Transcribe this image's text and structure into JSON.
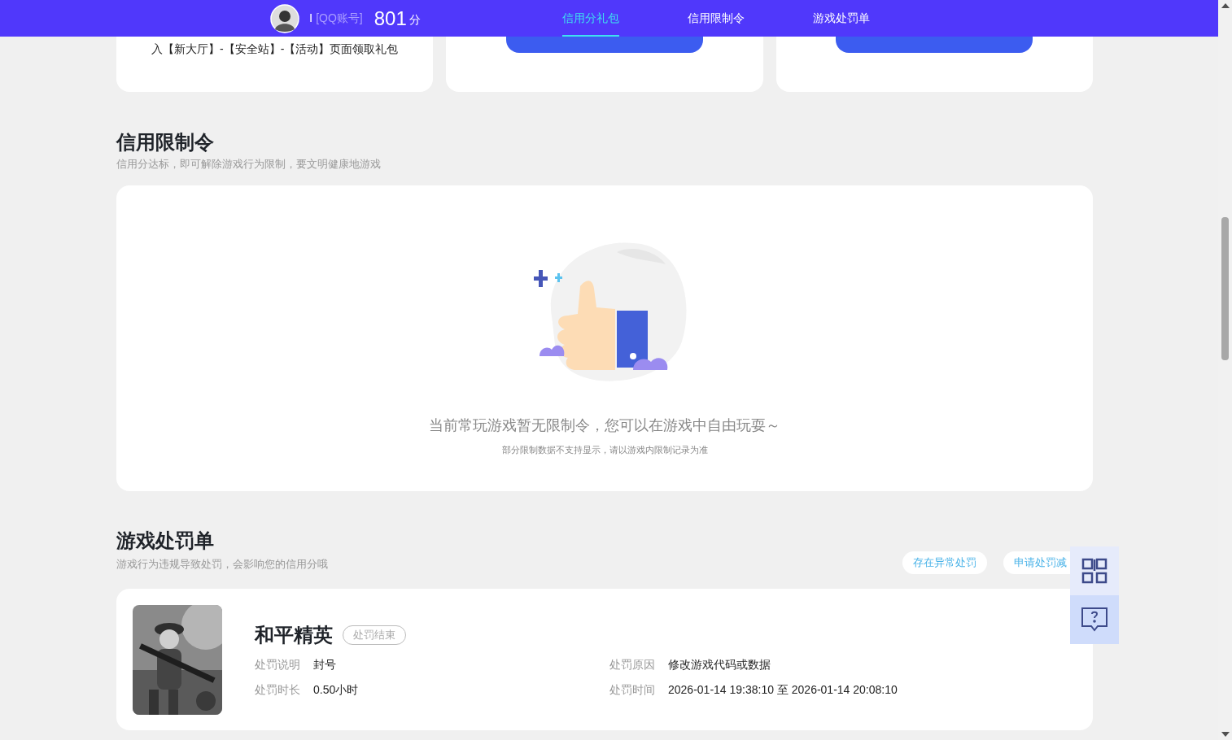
{
  "header": {
    "user": "I",
    "account": "[QQ账号]",
    "score": "801",
    "score_unit": "分",
    "tabs": [
      {
        "label": "信用分礼包",
        "selected": true
      },
      {
        "label": "信用限制令",
        "selected": false
      },
      {
        "label": "游戏处罚单",
        "selected": false
      }
    ]
  },
  "gift_cards": [
    {
      "kind": "text",
      "text": "入【新大厅】-【安全站】-【活动】页面领取礼包"
    },
    {
      "kind": "button"
    },
    {
      "kind": "button"
    }
  ],
  "restrictions": {
    "title": "信用限制令",
    "subtitle": "信用分达标，即可解除游戏行为限制，要文明健康地游戏",
    "empty_message": "当前常玩游戏暂无限制令，您可以在游戏中自由玩耍～",
    "empty_note": "部分限制数据不支持显示，请以游戏内限制记录为准"
  },
  "penalties": {
    "title": "游戏处罚单",
    "subtitle": "游戏行为违规导致处罚，会影响您的信用分哦",
    "actions": [
      "存在异常处罚",
      "申请处罚减"
    ],
    "records": [
      {
        "game": "和平精英",
        "status": "处罚结束",
        "fields": [
          {
            "label": "处罚说明",
            "value": "封号"
          },
          {
            "label": "处罚原因",
            "value": "修改游戏代码或数据"
          },
          {
            "label": "处罚时长",
            "value": "0.50小时"
          },
          {
            "label": "处罚时间",
            "value": "2026-01-14 19:38:10 至 2026-01-14 20:08:10"
          }
        ]
      }
    ]
  }
}
